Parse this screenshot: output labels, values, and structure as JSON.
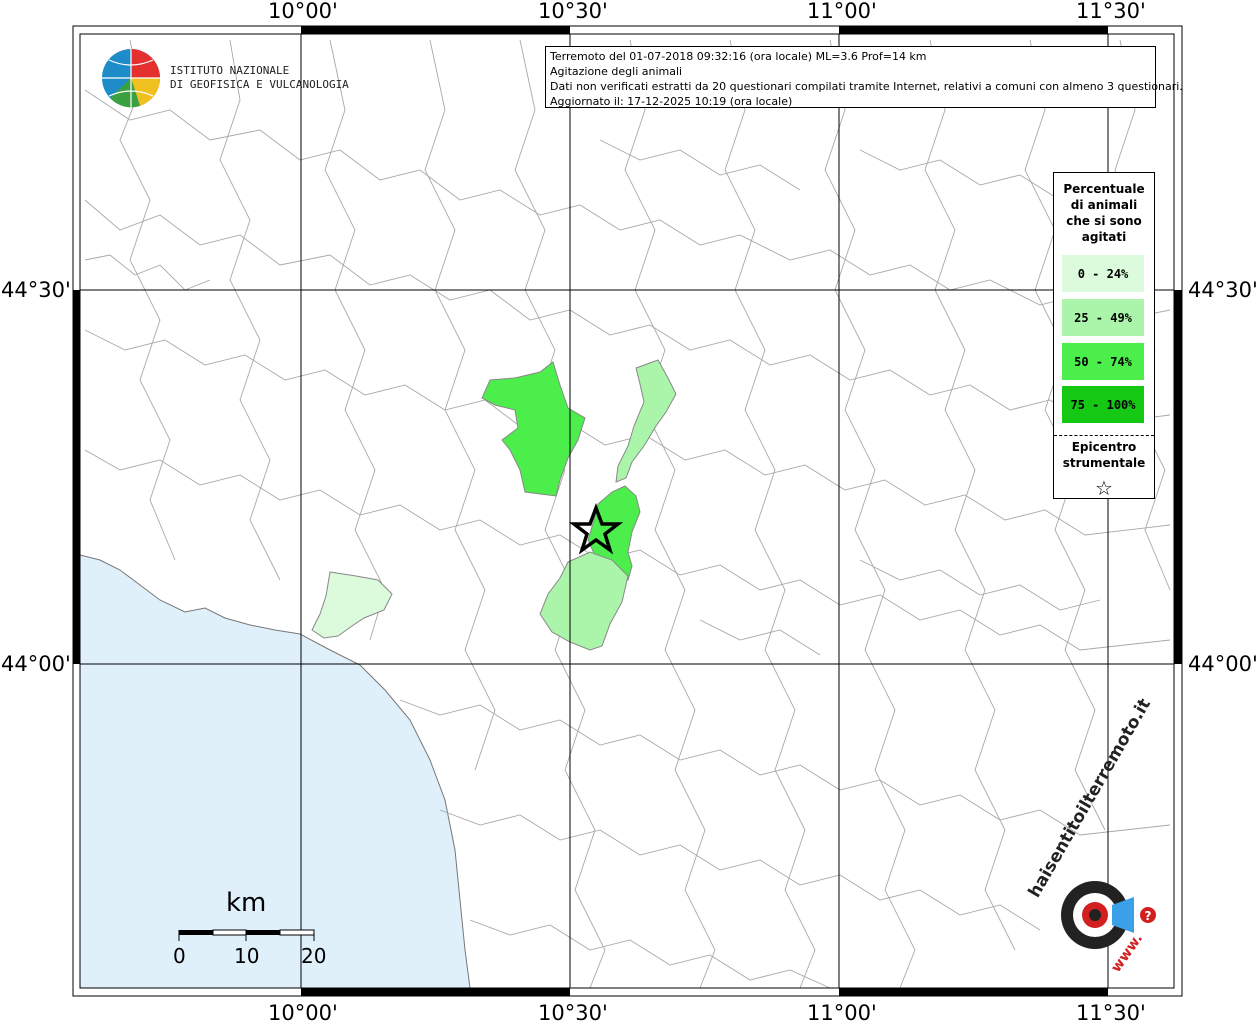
{
  "map": {
    "top_axis_labels": [
      "10°00'",
      "10°30'",
      "11°00'",
      "11°30'"
    ],
    "bottom_axis_labels": [
      "10°00'",
      "10°30'",
      "11°00'",
      "11°30'"
    ],
    "left_axis_labels": [
      "44°30'",
      "44°00'"
    ],
    "right_axis_labels": [
      "44°30'",
      "44°00'"
    ]
  },
  "logo": {
    "line1": "ISTITUTO NAZIONALE",
    "line2": "DI GEOFISICA E VULCANOLOGIA"
  },
  "info": {
    "line1": "Terremoto del 01-07-2018 09:32:16 (ora locale) ML=3.6 Prof=14 km",
    "line2": "Agitazione degli animali",
    "line3": "Dati non verificati estratti da 20 questionari compilati tramite Internet, relativi a comuni con almeno 3 questionari.",
    "line4": "Aggiornato il: 17-12-2025 10:19 (ora locale)"
  },
  "legend": {
    "title": "Percentuale di animali che si sono agitati",
    "classes": [
      {
        "label": "0 - 24%",
        "color": "#dcfadc"
      },
      {
        "label": "25 - 49%",
        "color": "#aaf5aa"
      },
      {
        "label": "50 - 74%",
        "color": "#4cee4c"
      },
      {
        "label": "75 - 100%",
        "color": "#14c814"
      }
    ],
    "epicenter_label": "Epicentro strumentale",
    "epicenter_symbol": "☆"
  },
  "scale": {
    "unit": "km",
    "ticks": [
      "0",
      "10",
      "20"
    ]
  },
  "watermark": {
    "text": "haisentitoilterremoto.it",
    "url_text": "www.",
    "accent_color": "#d22020"
  },
  "colors": {
    "sea": "#dff0fb",
    "land": "#ffffff",
    "boundary": "#9a9a9a",
    "grid": "#000000"
  }
}
